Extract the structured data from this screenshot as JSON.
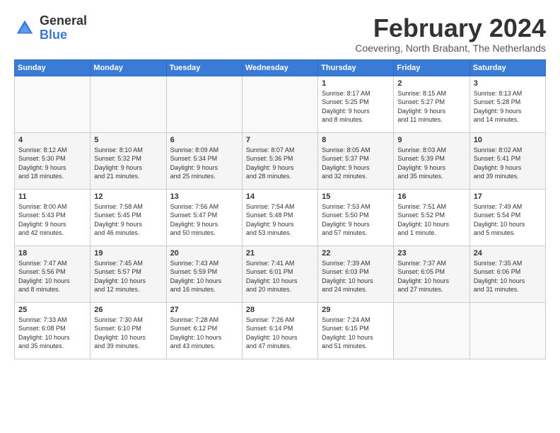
{
  "header": {
    "logo_general": "General",
    "logo_blue": "Blue",
    "month_title": "February 2024",
    "location": "Coevering, North Brabant, The Netherlands"
  },
  "weekdays": [
    "Sunday",
    "Monday",
    "Tuesday",
    "Wednesday",
    "Thursday",
    "Friday",
    "Saturday"
  ],
  "weeks": [
    [
      {
        "day": "",
        "info": ""
      },
      {
        "day": "",
        "info": ""
      },
      {
        "day": "",
        "info": ""
      },
      {
        "day": "",
        "info": ""
      },
      {
        "day": "1",
        "info": "Sunrise: 8:17 AM\nSunset: 5:25 PM\nDaylight: 9 hours\nand 8 minutes."
      },
      {
        "day": "2",
        "info": "Sunrise: 8:15 AM\nSunset: 5:27 PM\nDaylight: 9 hours\nand 11 minutes."
      },
      {
        "day": "3",
        "info": "Sunrise: 8:13 AM\nSunset: 5:28 PM\nDaylight: 9 hours\nand 14 minutes."
      }
    ],
    [
      {
        "day": "4",
        "info": "Sunrise: 8:12 AM\nSunset: 5:30 PM\nDaylight: 9 hours\nand 18 minutes."
      },
      {
        "day": "5",
        "info": "Sunrise: 8:10 AM\nSunset: 5:32 PM\nDaylight: 9 hours\nand 21 minutes."
      },
      {
        "day": "6",
        "info": "Sunrise: 8:09 AM\nSunset: 5:34 PM\nDaylight: 9 hours\nand 25 minutes."
      },
      {
        "day": "7",
        "info": "Sunrise: 8:07 AM\nSunset: 5:36 PM\nDaylight: 9 hours\nand 28 minutes."
      },
      {
        "day": "8",
        "info": "Sunrise: 8:05 AM\nSunset: 5:37 PM\nDaylight: 9 hours\nand 32 minutes."
      },
      {
        "day": "9",
        "info": "Sunrise: 8:03 AM\nSunset: 5:39 PM\nDaylight: 9 hours\nand 35 minutes."
      },
      {
        "day": "10",
        "info": "Sunrise: 8:02 AM\nSunset: 5:41 PM\nDaylight: 9 hours\nand 39 minutes."
      }
    ],
    [
      {
        "day": "11",
        "info": "Sunrise: 8:00 AM\nSunset: 5:43 PM\nDaylight: 9 hours\nand 42 minutes."
      },
      {
        "day": "12",
        "info": "Sunrise: 7:58 AM\nSunset: 5:45 PM\nDaylight: 9 hours\nand 46 minutes."
      },
      {
        "day": "13",
        "info": "Sunrise: 7:56 AM\nSunset: 5:47 PM\nDaylight: 9 hours\nand 50 minutes."
      },
      {
        "day": "14",
        "info": "Sunrise: 7:54 AM\nSunset: 5:48 PM\nDaylight: 9 hours\nand 53 minutes."
      },
      {
        "day": "15",
        "info": "Sunrise: 7:53 AM\nSunset: 5:50 PM\nDaylight: 9 hours\nand 57 minutes."
      },
      {
        "day": "16",
        "info": "Sunrise: 7:51 AM\nSunset: 5:52 PM\nDaylight: 10 hours\nand 1 minute."
      },
      {
        "day": "17",
        "info": "Sunrise: 7:49 AM\nSunset: 5:54 PM\nDaylight: 10 hours\nand 5 minutes."
      }
    ],
    [
      {
        "day": "18",
        "info": "Sunrise: 7:47 AM\nSunset: 5:56 PM\nDaylight: 10 hours\nand 8 minutes."
      },
      {
        "day": "19",
        "info": "Sunrise: 7:45 AM\nSunset: 5:57 PM\nDaylight: 10 hours\nand 12 minutes."
      },
      {
        "day": "20",
        "info": "Sunrise: 7:43 AM\nSunset: 5:59 PM\nDaylight: 10 hours\nand 16 minutes."
      },
      {
        "day": "21",
        "info": "Sunrise: 7:41 AM\nSunset: 6:01 PM\nDaylight: 10 hours\nand 20 minutes."
      },
      {
        "day": "22",
        "info": "Sunrise: 7:39 AM\nSunset: 6:03 PM\nDaylight: 10 hours\nand 24 minutes."
      },
      {
        "day": "23",
        "info": "Sunrise: 7:37 AM\nSunset: 6:05 PM\nDaylight: 10 hours\nand 27 minutes."
      },
      {
        "day": "24",
        "info": "Sunrise: 7:35 AM\nSunset: 6:06 PM\nDaylight: 10 hours\nand 31 minutes."
      }
    ],
    [
      {
        "day": "25",
        "info": "Sunrise: 7:33 AM\nSunset: 6:08 PM\nDaylight: 10 hours\nand 35 minutes."
      },
      {
        "day": "26",
        "info": "Sunrise: 7:30 AM\nSunset: 6:10 PM\nDaylight: 10 hours\nand 39 minutes."
      },
      {
        "day": "27",
        "info": "Sunrise: 7:28 AM\nSunset: 6:12 PM\nDaylight: 10 hours\nand 43 minutes."
      },
      {
        "day": "28",
        "info": "Sunrise: 7:26 AM\nSunset: 6:14 PM\nDaylight: 10 hours\nand 47 minutes."
      },
      {
        "day": "29",
        "info": "Sunrise: 7:24 AM\nSunset: 6:15 PM\nDaylight: 10 hours\nand 51 minutes."
      },
      {
        "day": "",
        "info": ""
      },
      {
        "day": "",
        "info": ""
      }
    ]
  ]
}
